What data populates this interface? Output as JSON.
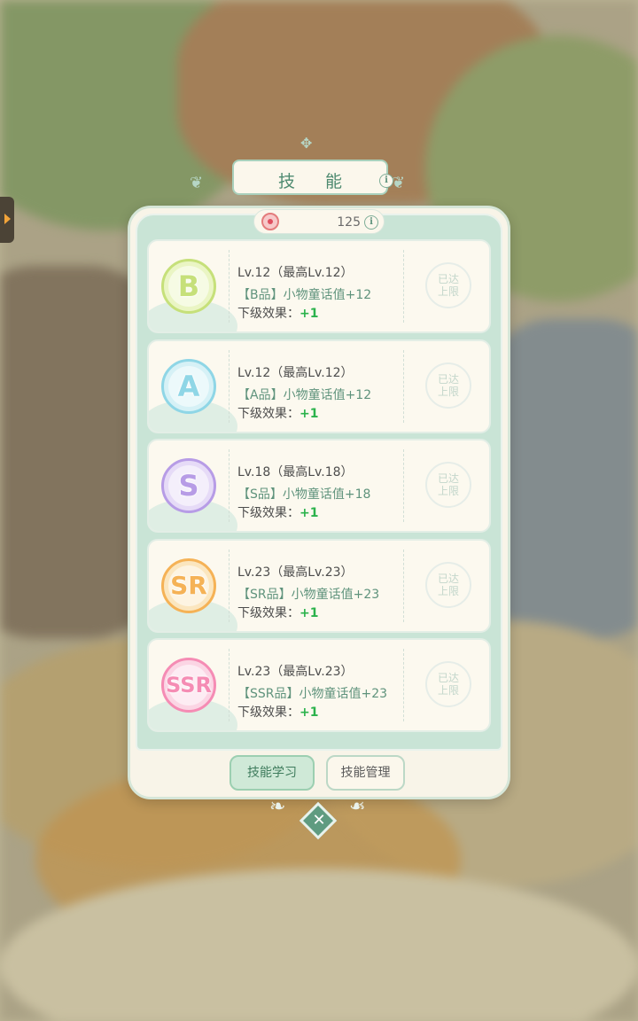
{
  "title": "技 能",
  "currency": {
    "value": "125"
  },
  "skills": [
    {
      "grade": "B",
      "level": "Lv.12（最高Lv.12）",
      "effect": "【B品】小物童话值+12",
      "next_label": "下级效果：",
      "next_value": "+1",
      "status": "已达上限",
      "color": "#c6e07a",
      "ring": "#eaf5c4"
    },
    {
      "grade": "A",
      "level": "Lv.12（最高Lv.12）",
      "effect": "【A品】小物童话值+12",
      "next_label": "下级效果：",
      "next_value": "+1",
      "status": "已达上限",
      "color": "#8fd6e6",
      "ring": "#d6f1f6"
    },
    {
      "grade": "S",
      "level": "Lv.18（最高Lv.18）",
      "effect": "【S品】小物童话值+18",
      "next_label": "下级效果：",
      "next_value": "+1",
      "status": "已达上限",
      "color": "#b79ce6",
      "ring": "#e6dbf7"
    },
    {
      "grade": "SR",
      "level": "Lv.23（最高Lv.23）",
      "effect": "【SR品】小物童话值+23",
      "next_label": "下级效果：",
      "next_value": "+1",
      "status": "已达上限",
      "color": "#f5b256",
      "ring": "#fbe6bf"
    },
    {
      "grade": "SSR",
      "level": "Lv.23（最高Lv.23）",
      "effect": "【SSR品】小物童话值+23",
      "next_label": "下级效果：",
      "next_value": "+1",
      "status": "已达上限",
      "color": "#f58cb4",
      "ring": "#fbd5e4"
    }
  ],
  "buttons": {
    "learn": "技能学习",
    "manage": "技能管理"
  },
  "icons": {
    "close": "close-icon",
    "info": "info-icon",
    "currency": "currency-icon"
  }
}
